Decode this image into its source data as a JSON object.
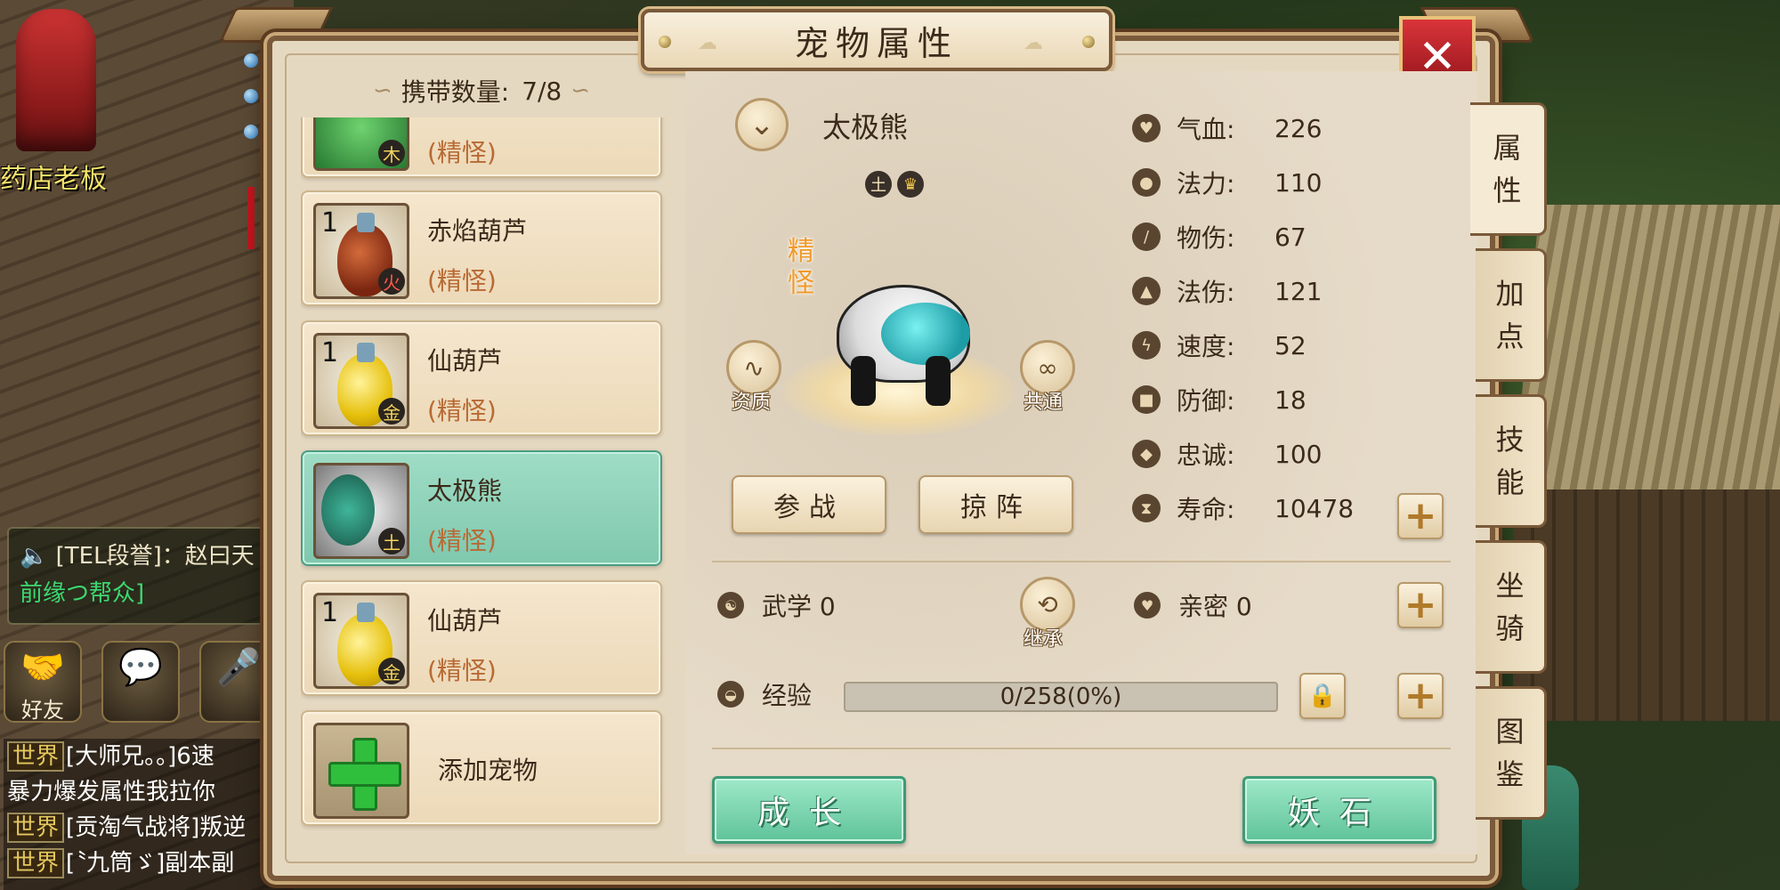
{
  "background": {
    "npc_name": "药店老板",
    "chat": {
      "speaker": "[TEL段誉]：赵曰天",
      "sub": "前缘つ帮众]"
    },
    "social": [
      {
        "label": "好友",
        "icon": "handshake-icon"
      },
      {
        "label": "",
        "icon": "chat-bubble-icon"
      },
      {
        "label": "",
        "icon": "microphone-icon"
      }
    ],
    "world_chat": [
      {
        "tag": "世界",
        "text": "[大师兄。。]6速"
      },
      {
        "tag": "",
        "text": "暴力爆发属性我拉你"
      },
      {
        "tag": "世界",
        "text": "[贡淘气战将]叛逆"
      },
      {
        "tag": "世界",
        "text": "[〝九筒ゞ]副本副"
      }
    ]
  },
  "window": {
    "title": "宠物属性",
    "close_label": "✕"
  },
  "list_panel": {
    "carry_label": "携带数量:",
    "carry_value": "7/8",
    "pets": [
      {
        "level": "",
        "name": "",
        "rank": "(精怪)",
        "element": "木",
        "kind": "tiger"
      },
      {
        "level": "1",
        "name": "赤焰葫芦",
        "rank": "(精怪)",
        "element": "火",
        "kind": "gourd-red"
      },
      {
        "level": "1",
        "name": "仙葫芦",
        "rank": "(精怪)",
        "element": "金",
        "kind": "gourd-gold"
      },
      {
        "level": "",
        "name": "太极熊",
        "rank": "(精怪)",
        "element": "土",
        "kind": "panda",
        "selected": true
      },
      {
        "level": "1",
        "name": "仙葫芦",
        "rank": "(精怪)",
        "element": "金",
        "kind": "gourd-gold"
      }
    ],
    "add_label": "添加宠物"
  },
  "pet": {
    "name": "太极熊",
    "element_badge": "土",
    "crown_badge": "♛",
    "rank_vertical": [
      "精",
      "怪"
    ],
    "aptitude_label": "资质",
    "common_label": "共通",
    "inherit_label": "继承",
    "fight_label": "参战",
    "formation_label": "掠阵"
  },
  "attributes": [
    {
      "label": "气血:",
      "value": "226",
      "icon": "heart-icon",
      "glyph": "♥"
    },
    {
      "label": "法力:",
      "value": "110",
      "icon": "water-drop-icon",
      "glyph": "●"
    },
    {
      "label": "物伤:",
      "value": "67",
      "icon": "sword-icon",
      "glyph": "/"
    },
    {
      "label": "法伤:",
      "value": "121",
      "icon": "flame-icon",
      "glyph": "▲"
    },
    {
      "label": "速度:",
      "value": "52",
      "icon": "lightning-icon",
      "glyph": "ϟ"
    },
    {
      "label": "防御:",
      "value": "18",
      "icon": "shield-icon",
      "glyph": "■"
    },
    {
      "label": "忠诚:",
      "value": "100",
      "icon": "handshake-icon",
      "glyph": "◆"
    },
    {
      "label": "寿命:",
      "value": "10478",
      "icon": "lifespan-icon",
      "glyph": "⧗"
    }
  ],
  "extra": {
    "martial_label": "武学 0",
    "intimacy_label": "亲密 0",
    "exp_label": "经验",
    "exp_text": "0/258(0%)",
    "exp_fraction": 0
  },
  "buttons": {
    "grow_label": "成长",
    "stone_label": "妖石"
  },
  "tabs": [
    {
      "label": "属性",
      "active": true
    },
    {
      "label": "加点"
    },
    {
      "label": "技能"
    },
    {
      "label": "坐骑"
    },
    {
      "label": "图鉴"
    }
  ]
}
